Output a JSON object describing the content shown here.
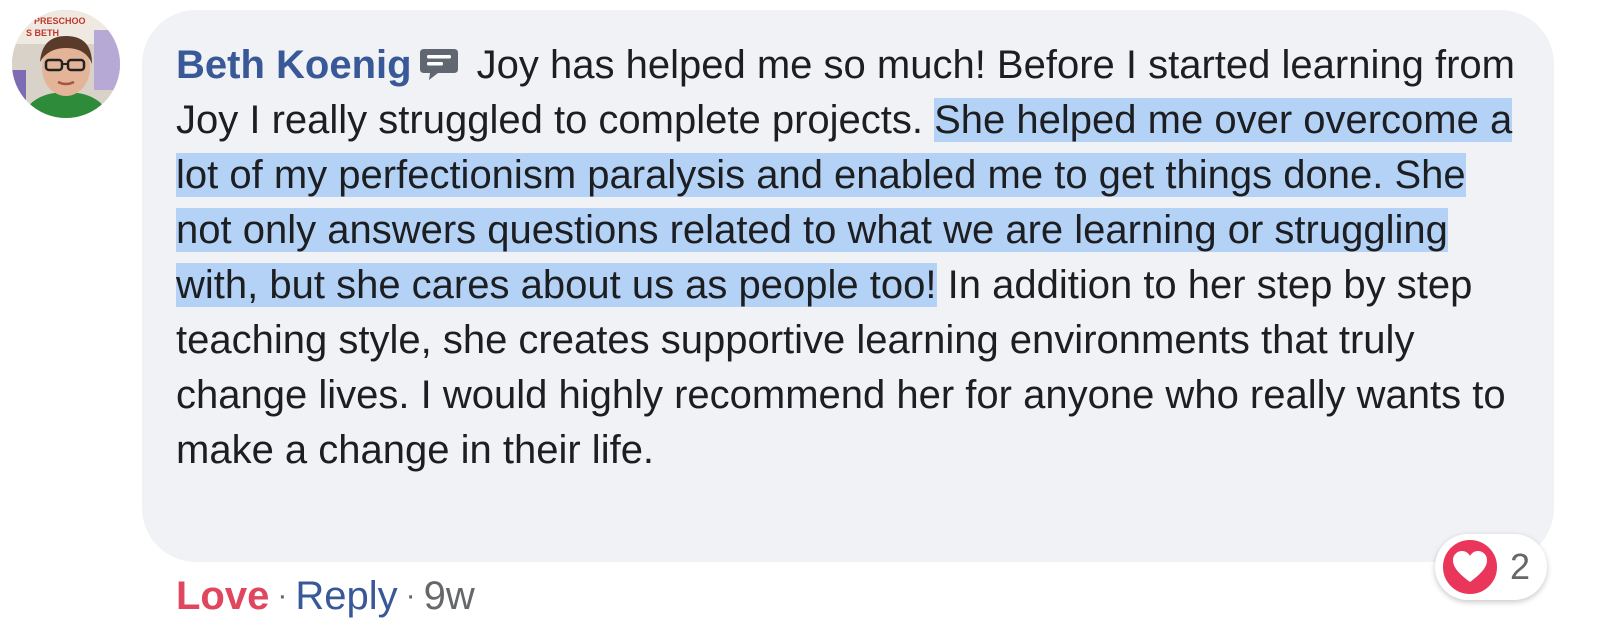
{
  "comment": {
    "author": "Beth Koenig",
    "avatar_icon": "profile-photo",
    "badge_icon": "speech-bubble-badge-icon",
    "text_before_highlight": " Joy has helped me so much! Before I started learning from Joy I really struggled to complete projects. ",
    "text_highlighted": "She helped me over overcome a lot of my perfectionism paralysis and enabled me to get things done. She not only answers questions related to what we are learning or struggling with, but she cares about us as people too!",
    "text_after_highlight": " In addition to her step by step teaching style, she creates supportive learning environments that truly change lives. I would highly recommend her for anyone who really wants to make a change in their life.",
    "avatar_lettering": [
      "PRESCHOO",
      "S BETH"
    ]
  },
  "actions": {
    "love_label": "Love",
    "separator": "·",
    "reply_label": "Reply",
    "time": "9w"
  },
  "reactions": {
    "icon": "heart-love-icon",
    "count": "2"
  },
  "colors": {
    "author": "#385898",
    "love": "#e0465e",
    "highlight": "#b4d2f6",
    "bubble": "#f0f2f5"
  }
}
